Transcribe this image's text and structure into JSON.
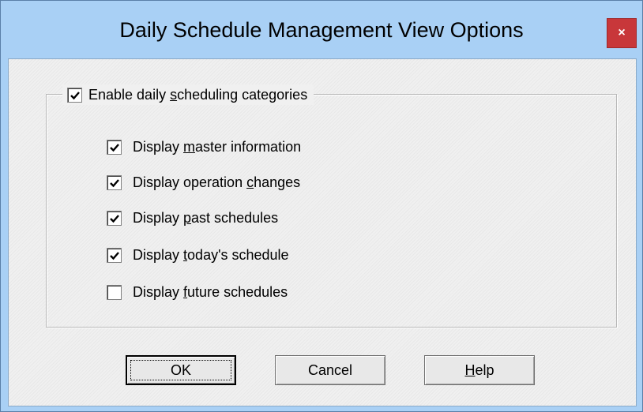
{
  "window": {
    "title": "Daily Schedule Management View Options",
    "close_label": "×"
  },
  "group": {
    "label_before": "Enable daily ",
    "label_mnemonic": "s",
    "label_after": "cheduling categories",
    "checked": true
  },
  "options": [
    {
      "before": "Display ",
      "mnemonic": "m",
      "after": "aster information",
      "checked": true
    },
    {
      "before": "Display operation ",
      "mnemonic": "c",
      "after": "hanges",
      "checked": true
    },
    {
      "before": "Display ",
      "mnemonic": "p",
      "after": "ast schedules",
      "checked": true
    },
    {
      "before": "Display ",
      "mnemonic": "t",
      "after": "oday's schedule",
      "checked": true
    },
    {
      "before": "Display ",
      "mnemonic": "f",
      "after": "uture schedules",
      "checked": false
    }
  ],
  "buttons": {
    "ok": "OK",
    "cancel": "Cancel",
    "help_mnemonic": "H",
    "help_rest": "elp"
  }
}
